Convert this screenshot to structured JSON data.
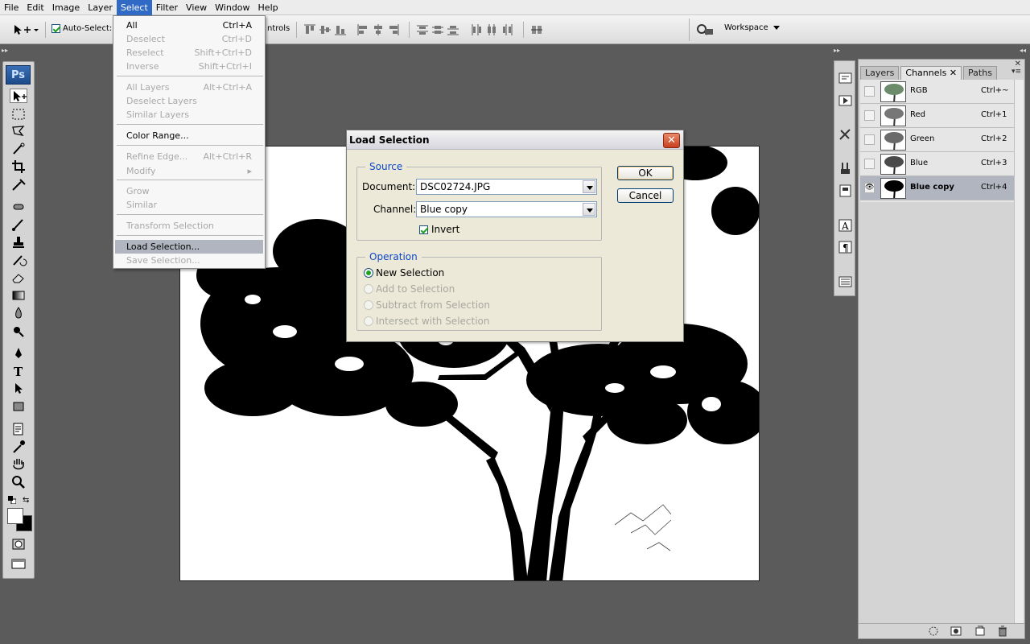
{
  "menubar": {
    "items": [
      "File",
      "Edit",
      "Image",
      "Layer",
      "Select",
      "Filter",
      "View",
      "Window",
      "Help"
    ],
    "active": "Select"
  },
  "options_bar": {
    "auto_select_label": "Auto-Select:",
    "auto_select_checked": true,
    "controls_partial_label": "ntrols",
    "workspace_label": "Workspace"
  },
  "toolbox": {
    "logo_text": "Ps"
  },
  "select_menu": {
    "items": [
      {
        "label": "All",
        "shortcut": "Ctrl+A",
        "enabled": true
      },
      {
        "label": "Deselect",
        "shortcut": "Ctrl+D",
        "enabled": false
      },
      {
        "label": "Reselect",
        "shortcut": "Shift+Ctrl+D",
        "enabled": false
      },
      {
        "label": "Inverse",
        "shortcut": "Shift+Ctrl+I",
        "enabled": false
      },
      {
        "label": "All Layers",
        "shortcut": "Alt+Ctrl+A",
        "enabled": false
      },
      {
        "label": "Deselect Layers",
        "shortcut": "",
        "enabled": false
      },
      {
        "label": "Similar Layers",
        "shortcut": "",
        "enabled": false
      },
      {
        "label": "Color Range...",
        "shortcut": "",
        "enabled": true
      },
      {
        "label": "Refine Edge...",
        "shortcut": "Alt+Ctrl+R",
        "enabled": false
      },
      {
        "label": "Modify",
        "shortcut": "",
        "enabled": false,
        "submenu": true
      },
      {
        "label": "Grow",
        "shortcut": "",
        "enabled": false
      },
      {
        "label": "Similar",
        "shortcut": "",
        "enabled": false
      },
      {
        "label": "Transform Selection",
        "shortcut": "",
        "enabled": false
      },
      {
        "label": "Load Selection...",
        "shortcut": "",
        "enabled": true,
        "highlighted": true
      },
      {
        "label": "Save Selection...",
        "shortcut": "",
        "enabled": false
      }
    ]
  },
  "dialog": {
    "title": "Load Selection",
    "source_legend": "Source",
    "document_label": "Document:",
    "document_value": "DSC02724.JPG",
    "channel_label": "Channel:",
    "channel_value": "Blue copy",
    "invert_label": "Invert",
    "invert_checked": true,
    "operation_legend": "Operation",
    "operations": [
      {
        "label": "New Selection",
        "selected": true,
        "enabled": true
      },
      {
        "label": "Add to Selection",
        "selected": false,
        "enabled": false
      },
      {
        "label": "Subtract from Selection",
        "selected": false,
        "enabled": false
      },
      {
        "label": "Intersect with Selection",
        "selected": false,
        "enabled": false
      }
    ],
    "ok_label": "OK",
    "cancel_label": "Cancel",
    "close_glyph": "✕"
  },
  "channels_panel": {
    "tabs": [
      "Layers",
      "Channels",
      "Paths"
    ],
    "active_tab": "Channels",
    "channels": [
      {
        "name": "RGB",
        "shortcut": "Ctrl+~",
        "visible": false,
        "active": false
      },
      {
        "name": "Red",
        "shortcut": "Ctrl+1",
        "visible": false,
        "active": false
      },
      {
        "name": "Green",
        "shortcut": "Ctrl+2",
        "visible": false,
        "active": false
      },
      {
        "name": "Blue",
        "shortcut": "Ctrl+3",
        "visible": false,
        "active": false
      },
      {
        "name": "Blue copy",
        "shortcut": "Ctrl+4",
        "visible": true,
        "active": true
      }
    ]
  },
  "colors": {
    "workspace_bg": "#5b5b5b",
    "menu_highlight": "#316ac5",
    "dialog_bg": "#ece9d8",
    "legend_blue": "#0b46c8",
    "active_row": "#b0b5c0"
  }
}
